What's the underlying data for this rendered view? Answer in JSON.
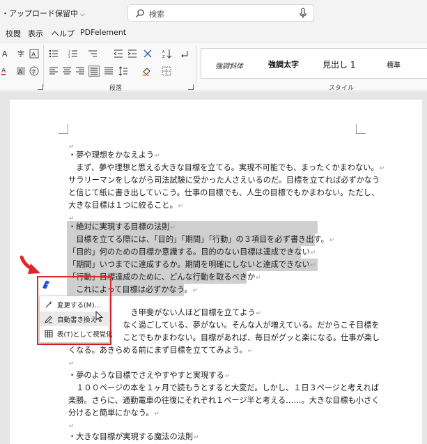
{
  "titlebar": {
    "save_status": "・アップロード保留中",
    "search_placeholder": "検索"
  },
  "tabs": [
    "校閲",
    "表示",
    "ヘルプ",
    "PDFelement"
  ],
  "ribbon": {
    "paragraph_group_label": "段落",
    "style_group_label": "スタイル",
    "styles": [
      "強調斜体",
      "強調太字",
      "見出し 1",
      "標準"
    ]
  },
  "document": {
    "lines": [
      "・夢や理想をかなえよう",
      "　まず、夢や理想と思える大きな目標を立てる。実現不可能でも、まったくかまわない。",
      "サラリーマンをしながら司法試験に受かった人さえいるのだ。目標を立てれば必ずかなう",
      "と信じて紙に書き出していこう。仕事の目標でも、人生の目標でもかまわない。ただし、",
      "大きな目標は１つに絞ること。",
      "",
      "・絶対に実現する目標の法則",
      "　目標を立てる際には、「目的」「期間」「行動」の３項目を必ず書き出す。",
      "「目的」何のための目標か意識する。目的のない目標は達成できない",
      "「期間」いつまでに達成するか。期間を明確にしないと達成できない",
      "「行動」目標達成のために、どんな行動を取るべきか",
      "　これによって目標は必ずかなう。",
      "　　　　　　　　き甲斐がない人ほど目標を立てよう",
      "　　　　　　　なく過ごしている、夢がない。そんな人が増えている。だからこそ目標を",
      "　　　　　　　ことでもかまわない。目標があれば、毎日がグッと楽になる。仕事が楽し",
      "くなる。あきらめる前にまず目標を立ててみよう。",
      "",
      "・夢のような目標でさえやすやすと実現する",
      "　１００ページの本を１ヶ月で読もうとすると大変だ。しかし、１日３ページと考えれば",
      "楽勝。さらに、通勤電車の往復にそれぞれ１ページ半と考える……。大きな目標も小さく",
      "分けると簡単にかなう。",
      "",
      "・大きな目標が実現する魔法の法則"
    ]
  },
  "copilot_menu": {
    "items": [
      {
        "label": "変更する(M)...",
        "icon": "sparkle-pen-icon"
      },
      {
        "label": "自動書き換え",
        "icon": "rewrite-pen-icon"
      },
      {
        "label": "表(T)として視覚化",
        "icon": "table-icon"
      }
    ]
  },
  "colors": {
    "highlight_box": "#e02727",
    "selection": "#cfcfcf",
    "arrow": "#e02727"
  }
}
